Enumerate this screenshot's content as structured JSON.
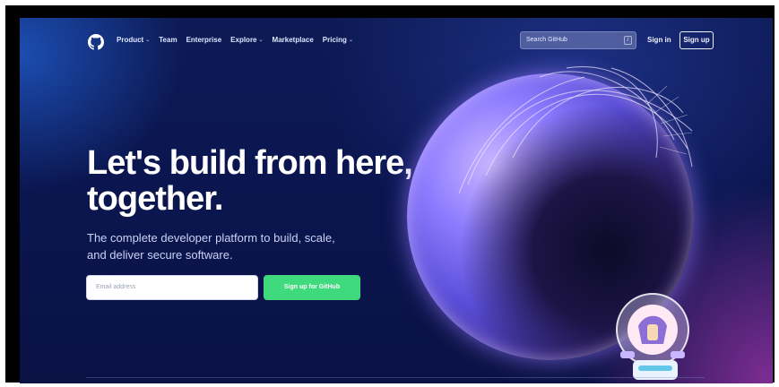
{
  "nav": {
    "logo": "github-logo-icon",
    "items": [
      {
        "label": "Product",
        "has_dropdown": true
      },
      {
        "label": "Team",
        "has_dropdown": false
      },
      {
        "label": "Enterprise",
        "has_dropdown": false
      },
      {
        "label": "Explore",
        "has_dropdown": true
      },
      {
        "label": "Marketplace",
        "has_dropdown": false
      },
      {
        "label": "Pricing",
        "has_dropdown": true
      }
    ],
    "dropdown_glyph": "⌄",
    "search_placeholder": "Search GitHub",
    "search_shortcut": "/",
    "sign_in": "Sign in",
    "sign_up": "Sign up"
  },
  "hero": {
    "headline": "Let's build from here, together.",
    "subtext": "The complete developer platform to build, scale, and deliver secure software.",
    "email_placeholder": "Email address",
    "cta_label": "Sign up for GitHub"
  },
  "colors": {
    "background": "#0b1650",
    "cta": "#3fd97e",
    "globe": "#5a4ed8",
    "accent_glow": "#be3cbe"
  }
}
